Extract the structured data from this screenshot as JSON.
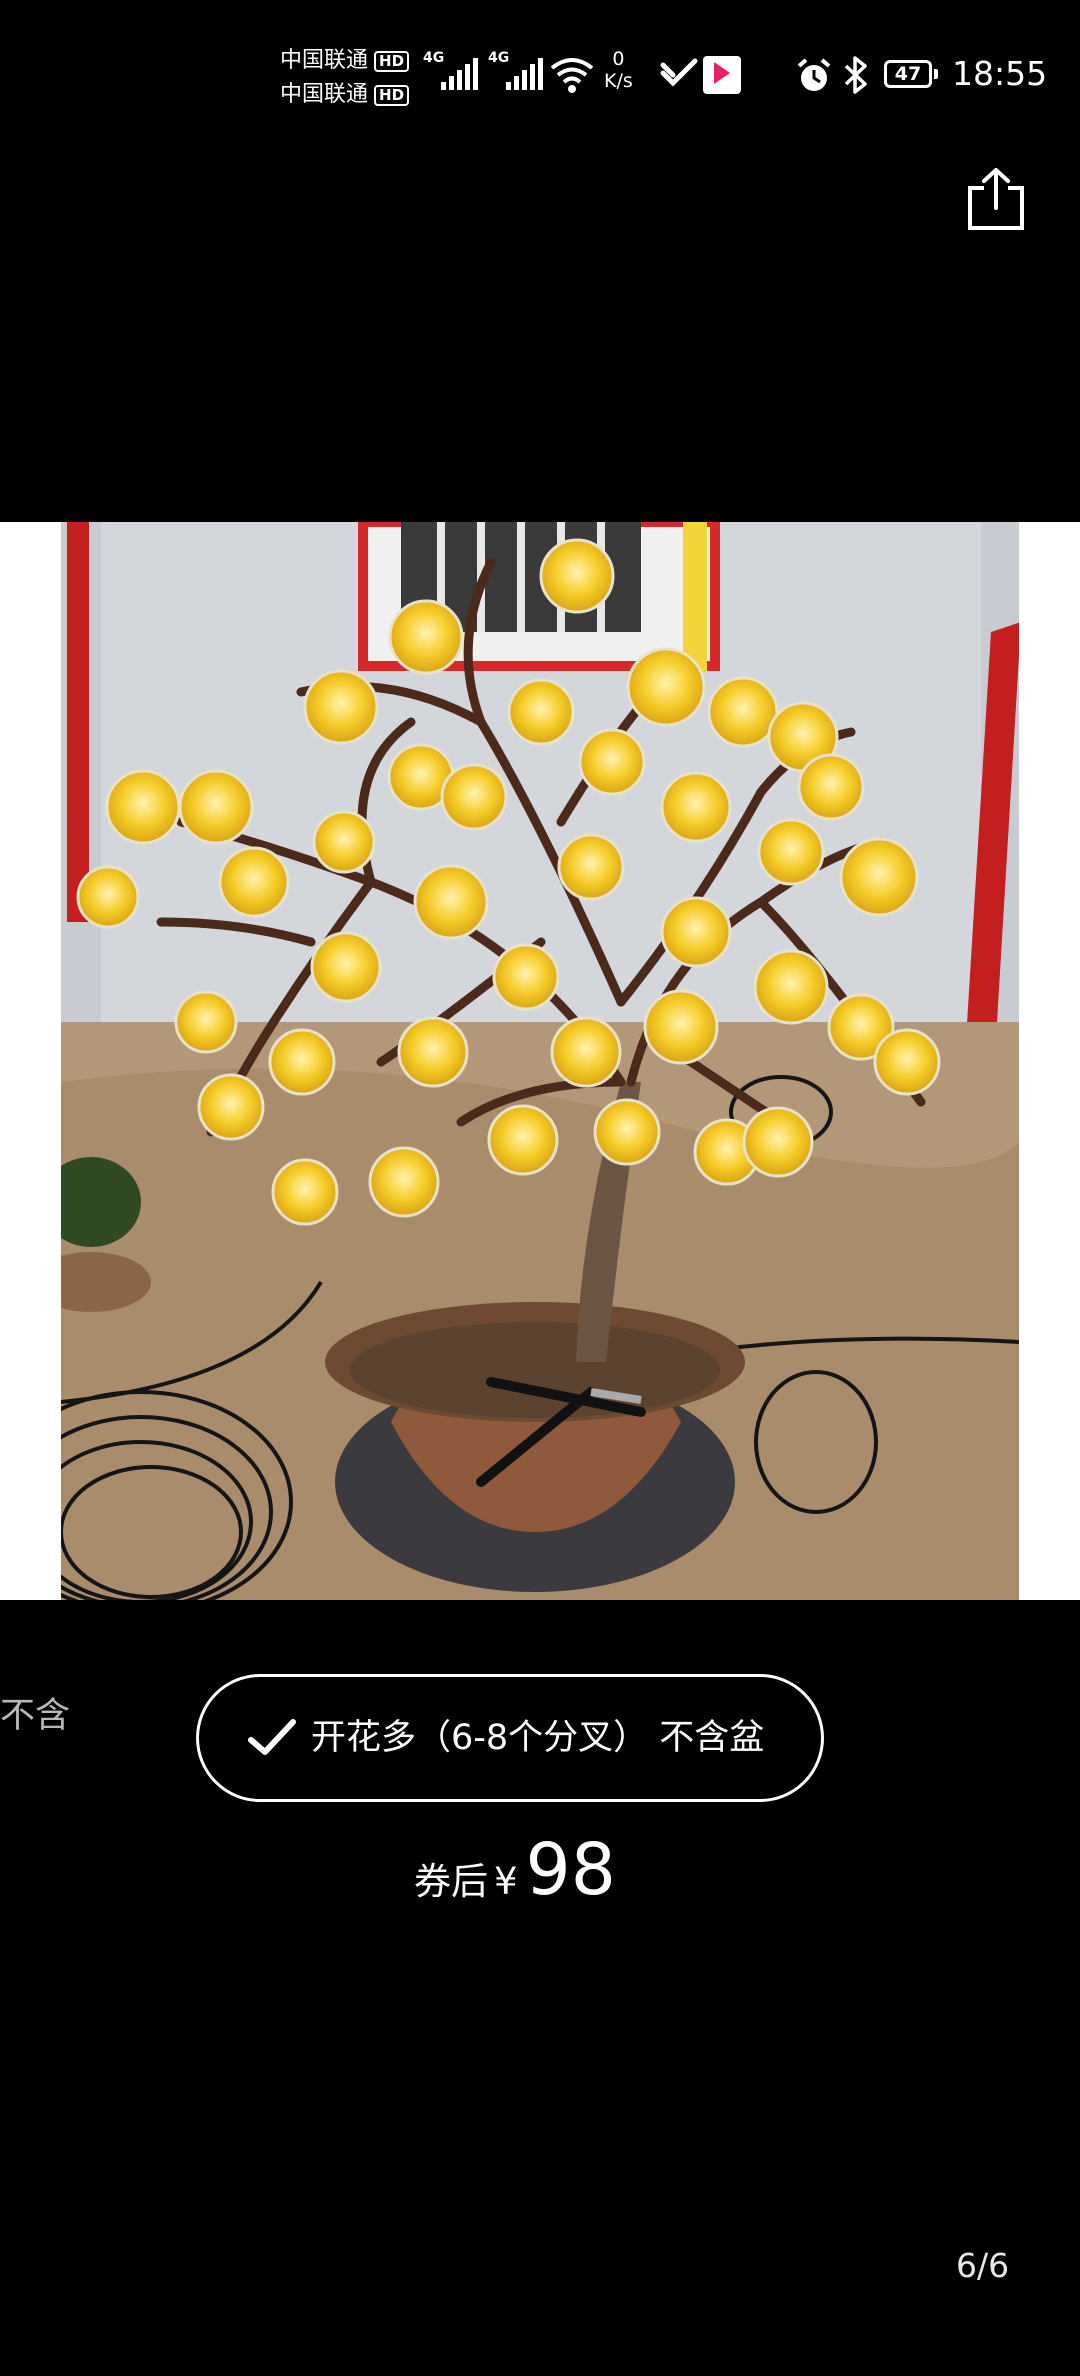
{
  "status_bar": {
    "carrier1": "中国联通",
    "carrier2": "中国联通",
    "hd_badge": "HD",
    "network1": "4G",
    "network2": "4G",
    "net_speed_value": "0",
    "net_speed_unit": "K/s",
    "battery_level": "47",
    "time": "18:55"
  },
  "viewer": {
    "prev_variant_partial": "不含",
    "selected_variant": "开花多（6-8个分叉） 不含盆",
    "price_prefix": "券后",
    "price_currency": "¥",
    "price_value": "98",
    "page_indicator": "6/6"
  },
  "colors": {
    "background": "#000000",
    "flower": "#f6cd2a",
    "branch": "#4b2a1c"
  }
}
